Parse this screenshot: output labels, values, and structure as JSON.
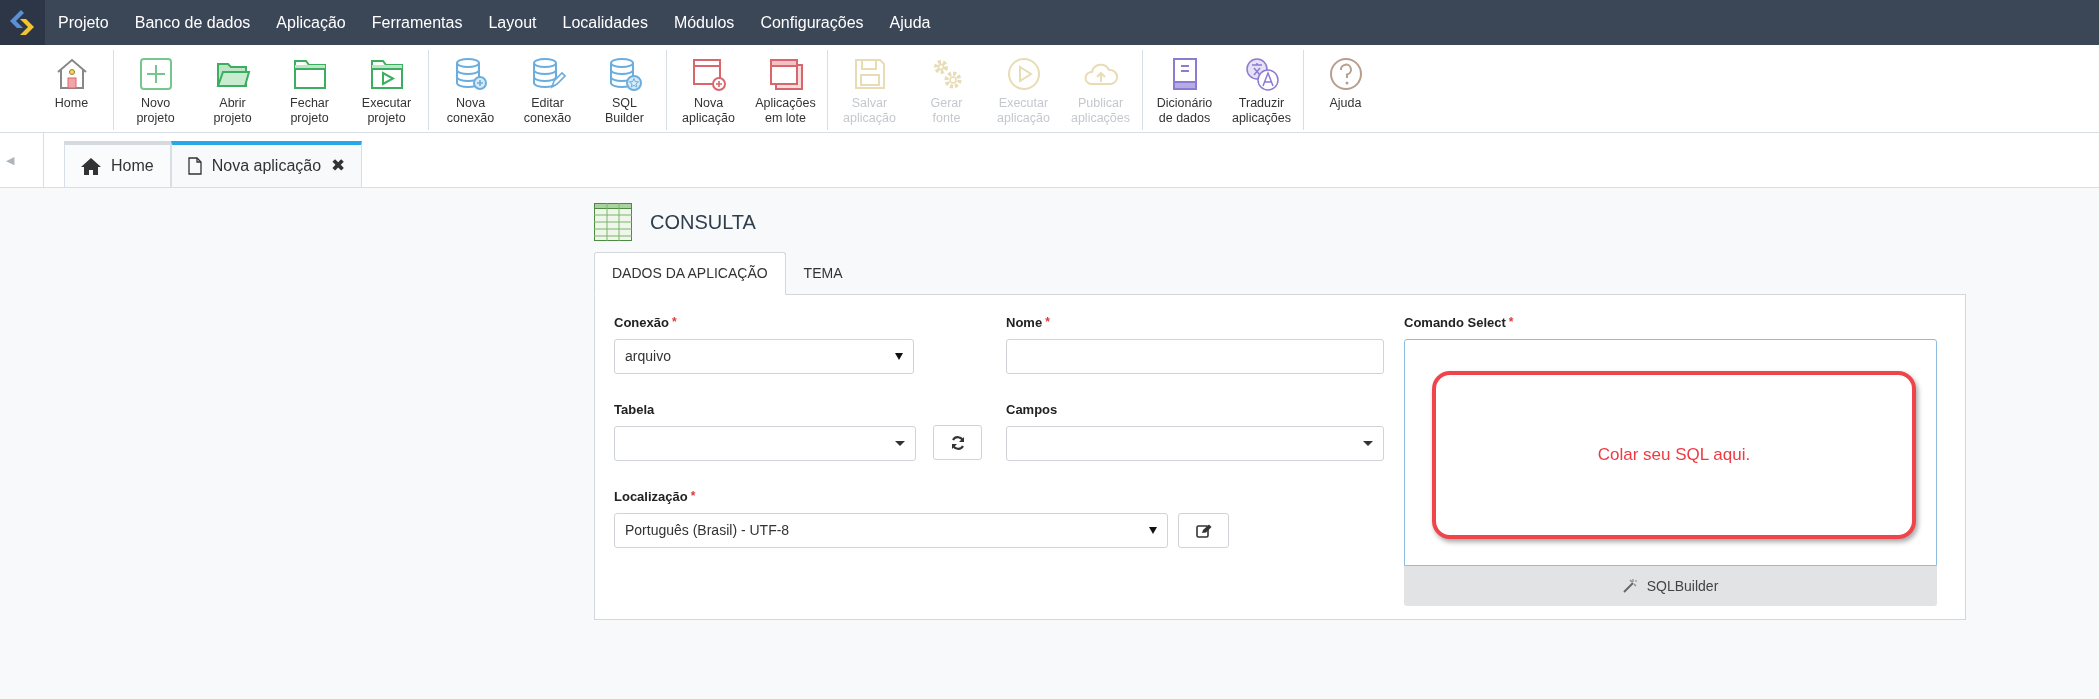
{
  "menu": [
    "Projeto",
    "Banco de dados",
    "Aplicação",
    "Ferramentas",
    "Layout",
    "Localidades",
    "Módulos",
    "Configurações",
    "Ajuda"
  ],
  "toolbar": [
    [
      {
        "lines": [
          "Home"
        ],
        "disabled": false
      }
    ],
    [
      {
        "lines": [
          "Novo",
          "projeto"
        ],
        "disabled": false
      },
      {
        "lines": [
          "Abrir",
          "projeto"
        ],
        "disabled": false
      },
      {
        "lines": [
          "Fechar",
          "projeto"
        ],
        "disabled": false
      },
      {
        "lines": [
          "Executar",
          "projeto"
        ],
        "disabled": false
      }
    ],
    [
      {
        "lines": [
          "Nova",
          "conexão"
        ],
        "disabled": false
      },
      {
        "lines": [
          "Editar",
          "conexão"
        ],
        "disabled": false
      },
      {
        "lines": [
          "SQL",
          "Builder"
        ],
        "disabled": false
      }
    ],
    [
      {
        "lines": [
          "Nova",
          "aplicação"
        ],
        "disabled": false
      },
      {
        "lines": [
          "Aplicações",
          "em lote"
        ],
        "disabled": false
      }
    ],
    [
      {
        "lines": [
          "Salvar",
          "aplicação"
        ],
        "disabled": true
      },
      {
        "lines": [
          "Gerar",
          "fonte"
        ],
        "disabled": true
      },
      {
        "lines": [
          "Executar",
          "aplicação"
        ],
        "disabled": true
      },
      {
        "lines": [
          "Publicar",
          "aplicações"
        ],
        "disabled": true
      }
    ],
    [
      {
        "lines": [
          "Dicionário",
          "de dados"
        ],
        "disabled": false
      },
      {
        "lines": [
          "Traduzir",
          "aplicações"
        ],
        "disabled": false
      }
    ],
    [
      {
        "lines": [
          "Ajuda"
        ],
        "disabled": false
      }
    ]
  ],
  "scroll_left": "◀",
  "doc_tabs": [
    {
      "label": "Home",
      "selected": false
    },
    {
      "label": "Nova aplicação",
      "selected": true,
      "close": "✖"
    }
  ],
  "page": {
    "title": "CONSULTA",
    "tabs": [
      {
        "label": "DADOS DA APLICAÇÃO",
        "selected": true
      },
      {
        "label": "TEMA",
        "selected": false
      }
    ],
    "conexao": {
      "label": "Conexão",
      "required_mark": "*",
      "value": "arquivo"
    },
    "nome": {
      "label": "Nome",
      "required_mark": "*"
    },
    "tabela": {
      "label": "Tabela"
    },
    "campos": {
      "label": "Campos"
    },
    "localizacao": {
      "label": "Localização",
      "required_mark": "*",
      "value": "Português (Brasil) - UTF-8"
    },
    "comando": {
      "label": "Comando Select",
      "required_mark": "*"
    },
    "callout": "Colar seu SQL aqui.",
    "sql_builder": "SQLBuilder"
  }
}
